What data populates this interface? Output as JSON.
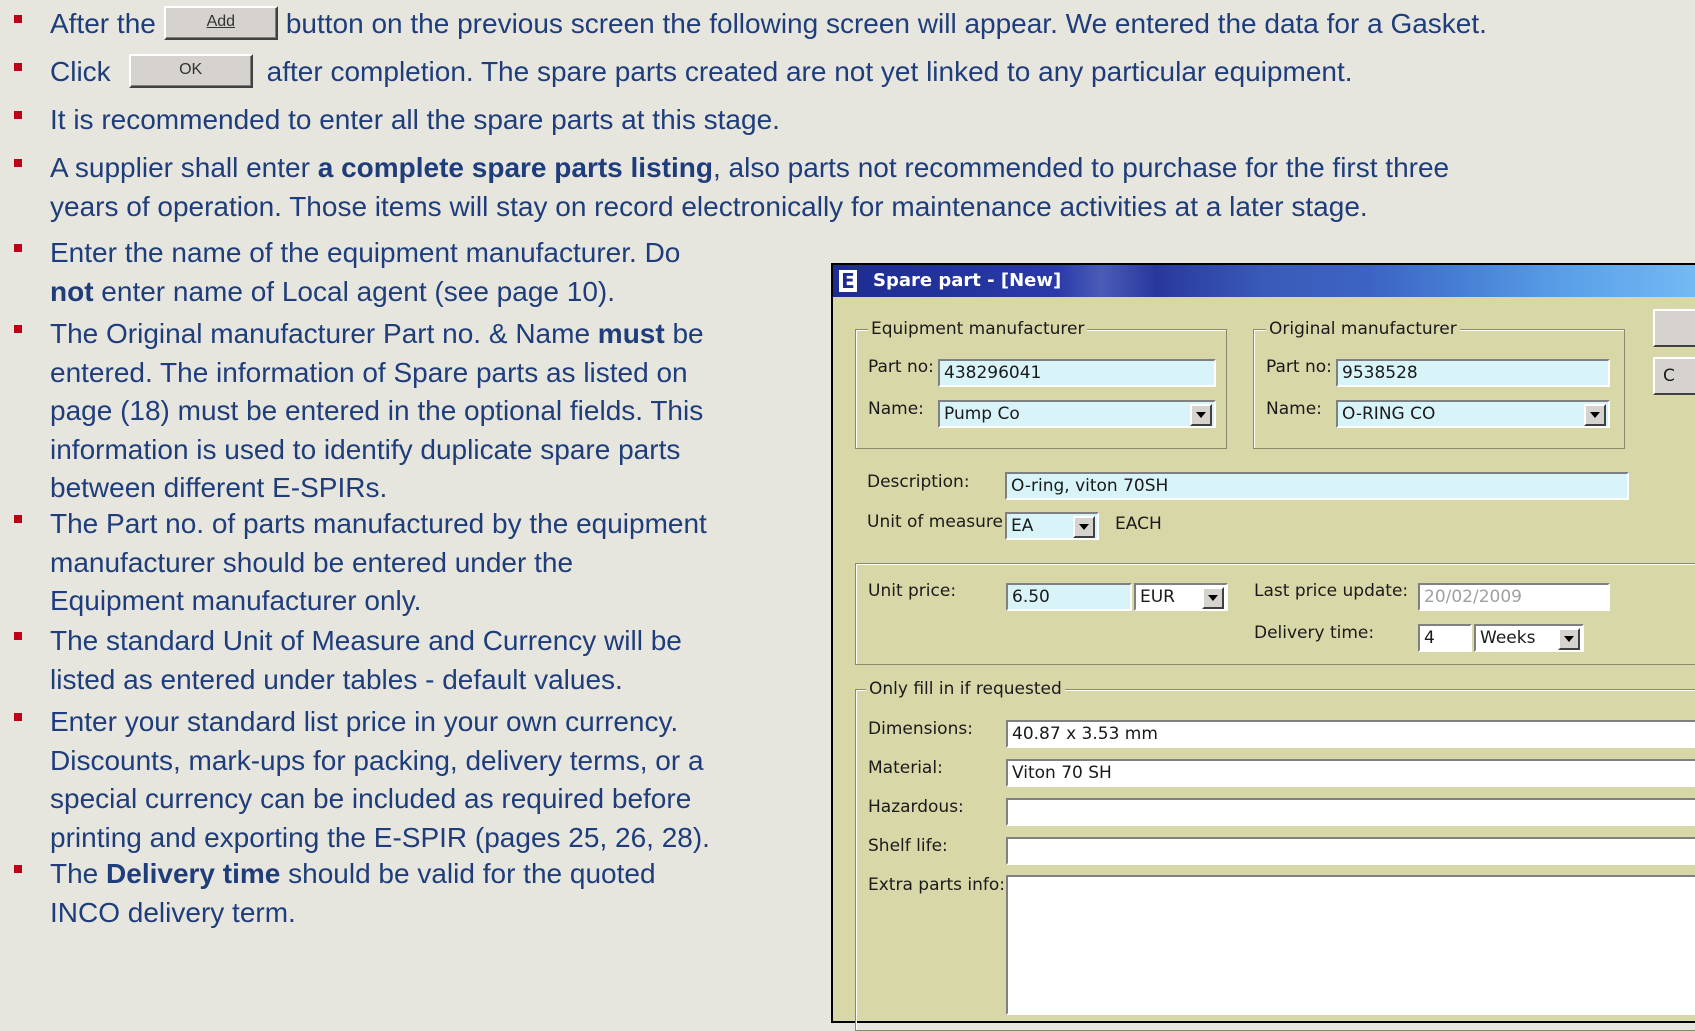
{
  "bullets": [
    {
      "pre": "After the",
      "button": "Add",
      "post": "button on the previous screen the following screen will appear.  We entered the data for a Gasket."
    },
    {
      "pre": "Click",
      "button": "OK",
      "post": "after completion.   The spare parts created are not yet linked to any particular equipment."
    },
    {
      "line1": "It is recommended to enter all the spare parts at this stage."
    },
    {
      "l1a": "A supplier shall enter ",
      "l1b": "a complete spare parts listing",
      "l1c": ", also parts not recommended to purchase for the first three",
      "line2": "years of operation.  Those items will stay on record electronically for maintenance activities at a later stage."
    },
    {
      "line1": "Enter the name of the equipment manufacturer. Do",
      "l2b": "not",
      "l2c": " enter name of Local agent (see page 10)."
    },
    {
      "l1a": "The Original manufacturer Part no. & Name ",
      "l1b": "must",
      "l1c": " be",
      "line2": "entered.  The information of Spare parts as listed on",
      "line3": "page (18) must be entered in the optional fields.  This",
      "line4": "information is used to identify duplicate spare parts",
      "line5": "between different E-SPIRs."
    },
    {
      "line1": "The Part no. of parts manufactured by the equipment",
      "line2": "manufacturer should be entered under the",
      "line3": "Equipment manufacturer only."
    },
    {
      "line1": "The standard Unit of Measure and Currency will be",
      "line2": "listed as entered under tables - default values."
    },
    {
      "line1": "Enter your standard list price in your own currency.",
      "line2": "Discounts, mark-ups for packing, delivery terms, or a",
      "line3": "special currency can be included as required before",
      "line4": "printing and exporting the E-SPIR (pages 25, 26, 28)."
    },
    {
      "l1a": "The ",
      "l1b": "Delivery time",
      "l1c": " should be valid for the quoted",
      "line2": "INCO delivery term."
    }
  ],
  "dialog": {
    "title": "Spare part - [New]",
    "icon_letter": "E",
    "equipment_manufacturer": {
      "legend": "Equipment manufacturer",
      "part_no_label": "Part no:",
      "part_no": "438296041",
      "name_label": "Name:",
      "name": "Pump Co"
    },
    "original_manufacturer": {
      "legend": "Original manufacturer",
      "part_no_label": "Part no:",
      "part_no": "9538528",
      "name_label": "Name:",
      "name": "O-RING CO"
    },
    "description_label": "Description:",
    "description": "O-ring, viton 70SH",
    "uom_label": "Unit of measure:",
    "uom": "EA",
    "uom_text": "EACH",
    "unit_price_label": "Unit price:",
    "unit_price": "6.50",
    "currency": "EUR",
    "last_price_update_label": "Last price update:",
    "last_price_update": "20/02/2009",
    "delivery_time_label": "Delivery time:",
    "delivery_time": "4",
    "delivery_unit": "Weeks",
    "optional_legend": "Only fill in if requested",
    "dimensions_label": "Dimensions:",
    "dimensions": "40.87 x 3.53 mm",
    "material_label": "Material:",
    "material": "Viton 70 SH",
    "hazardous_label": "Hazardous:",
    "hazardous": "",
    "shelf_life_label": "Shelf life:",
    "shelf_life": "",
    "extra_label": "Extra parts info:",
    "extra": "",
    "side_button_2_partial": "C"
  }
}
